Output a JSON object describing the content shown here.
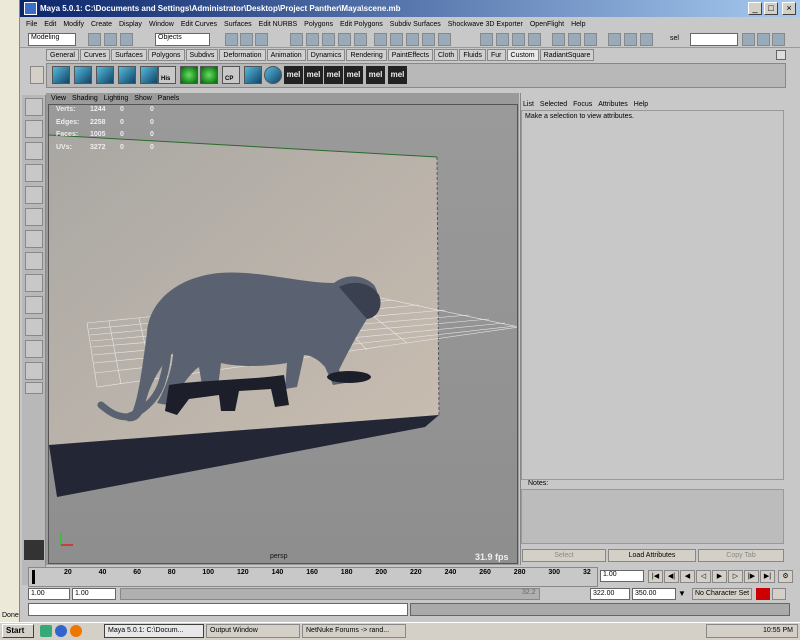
{
  "window": {
    "title": "Maya 5.0.1: C:\\Documents and Settings\\Administrator\\Desktop\\Project Panther\\Maya\\scene.mb"
  },
  "menubar": [
    "File",
    "Edit",
    "Modify",
    "Create",
    "Display",
    "Window",
    "Edit Curves",
    "Surfaces",
    "Edit NURBS",
    "Polygons",
    "Edit Polygons",
    "Subdiv Surfaces",
    "Shockwave 3D Exporter",
    "OpenFlight",
    "Help"
  ],
  "statusline": {
    "mode": "Modeling",
    "objects": "Objects",
    "sel_label": "sel"
  },
  "shelf": {
    "tabs": [
      "General",
      "Curves",
      "Surfaces",
      "Polygons",
      "Subdivs",
      "Deformation",
      "Animation",
      "Dynamics",
      "Rendering",
      "PaintEffects",
      "Cloth",
      "Fluids",
      "Fur",
      "Custom",
      "RadiantSquare"
    ],
    "active_tab": "Custom",
    "labels": [
      "His",
      "CP"
    ],
    "mel_buttons": [
      "mel",
      "mel",
      "mel",
      "mel",
      "mel",
      "mel"
    ]
  },
  "viewport": {
    "menu": [
      "View",
      "Shading",
      "Lighting",
      "Show",
      "Panels"
    ],
    "hud": [
      {
        "label": "Verts:",
        "a": "1244",
        "b": "0",
        "c": "0"
      },
      {
        "label": "Edges:",
        "a": "2258",
        "b": "0",
        "c": "0"
      },
      {
        "label": "Faces:",
        "a": "1005",
        "b": "0",
        "c": "0"
      },
      {
        "label": "UVs:",
        "a": "3272",
        "b": "0",
        "c": "0"
      }
    ],
    "camera": "persp",
    "fps": "31.9 fps"
  },
  "attribute_editor": {
    "menu": [
      "List",
      "Selected",
      "Focus",
      "Attributes",
      "Help"
    ],
    "message": "Make a selection to view attributes.",
    "notes_label": "Notes:",
    "buttons": [
      "Select",
      "Load Attributes",
      "Copy Tab"
    ]
  },
  "timeslider": {
    "ticks": [
      "20",
      "40",
      "60",
      "80",
      "100",
      "120",
      "140",
      "160",
      "180",
      "200",
      "220",
      "240",
      "260",
      "280",
      "300",
      "32"
    ],
    "current": "1.00"
  },
  "range": {
    "start": "1.00",
    "start2": "1.00",
    "bar_value": "32.2",
    "end": "322.00",
    "end2": "350.00",
    "character_set": "No Character Set"
  },
  "ie_status": "Done",
  "taskbar": {
    "start": "Start",
    "tasks": [
      "Maya 5.0.1: C:\\Docum...",
      "Output Window",
      "NetNuke Forums -> rand..."
    ],
    "clock": "10:55 PM"
  }
}
